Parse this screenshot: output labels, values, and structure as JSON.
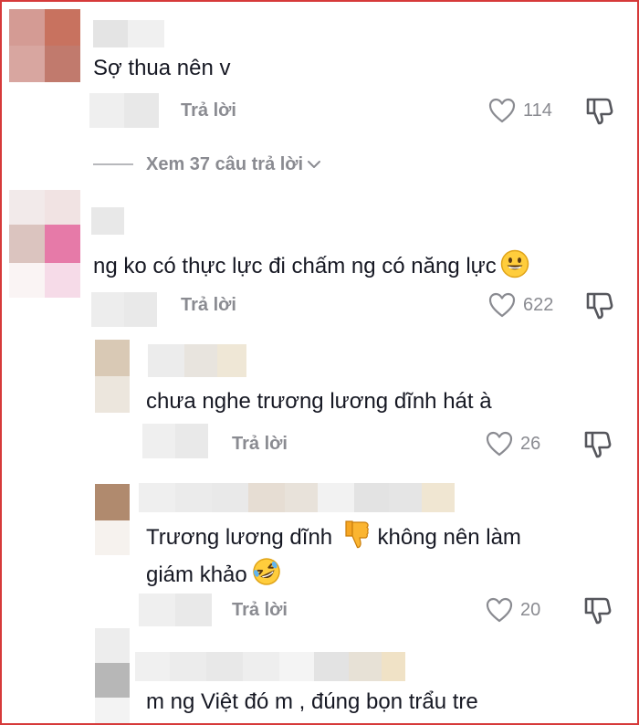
{
  "comments": [
    {
      "text": "Sợ thua nên v",
      "reply_label": "Trả lời",
      "likes": "114"
    },
    {
      "text": "ng ko có thực lực đi chấm ng có năng lực",
      "emoji": "smile-emoji",
      "reply_label": "Trả lời",
      "likes": "622",
      "replies": [
        {
          "text": "chưa nghe trương lương dĩnh hát à",
          "reply_label": "Trả lời",
          "likes": "26"
        },
        {
          "text_line1": "Trương lương dĩnh",
          "emoji1": "thumbs-down-emoji",
          "text_line1b": "không nên làm",
          "text_line2": "giám khảo",
          "emoji2": "rofl-emoji",
          "reply_label": "Trả lời",
          "likes": "20"
        },
        {
          "text": "m ng Việt đó m , đúng bọn trẩu tre"
        }
      ]
    }
  ],
  "view_replies_label": "Xem 37 câu trả lời",
  "colors": {
    "text": "#161823",
    "muted": "#8a8b91",
    "frame_border": "#d63a3a"
  }
}
